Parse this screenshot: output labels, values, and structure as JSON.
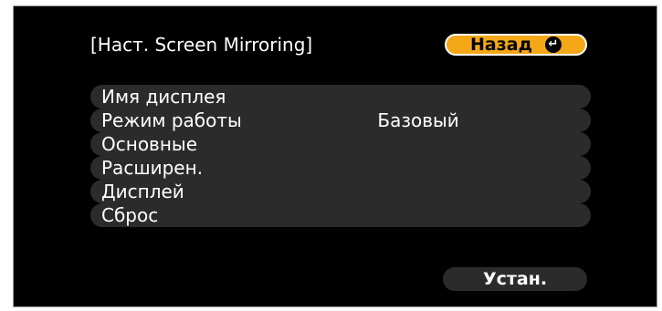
{
  "dialog": {
    "title": "[Наст. Screen Mirroring]",
    "back_label": "Назад",
    "back_icon": "enter-icon",
    "set_label": "Устан."
  },
  "menu": {
    "items": [
      {
        "label": "Имя дисплея",
        "value": ""
      },
      {
        "label": "Режим работы",
        "value": "Базовый"
      },
      {
        "label": "Основные",
        "value": ""
      },
      {
        "label": "Расширен.",
        "value": ""
      },
      {
        "label": "Дисплей",
        "value": ""
      },
      {
        "label": "Сброс",
        "value": ""
      }
    ]
  },
  "colors": {
    "background": "#000000",
    "item_fill": "#2b2b2b",
    "back_button_fill": "#f4a817",
    "text": "#ffffff"
  }
}
